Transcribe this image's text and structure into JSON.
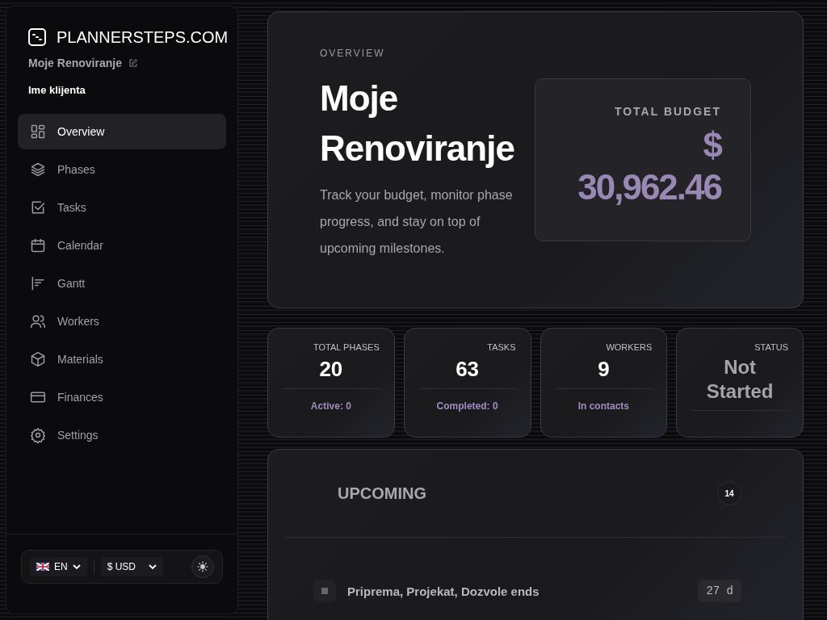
{
  "brand": {
    "name": "PLANNERSTEPS.COM"
  },
  "project": {
    "name": "Moje Renoviranje",
    "client": "Ime klijenta"
  },
  "nav": [
    {
      "label": "Overview",
      "selected": true
    },
    {
      "label": "Phases",
      "selected": false
    },
    {
      "label": "Tasks",
      "selected": false
    },
    {
      "label": "Calendar",
      "selected": false
    },
    {
      "label": "Gantt",
      "selected": false
    },
    {
      "label": "Workers",
      "selected": false
    },
    {
      "label": "Materials",
      "selected": false
    },
    {
      "label": "Finances",
      "selected": false
    },
    {
      "label": "Settings",
      "selected": false
    }
  ],
  "footer": {
    "language": "EN",
    "currency": "$ USD"
  },
  "hero": {
    "eyebrow": "OVERVIEW",
    "title": "Moje Renoviranje",
    "description": "Track your budget, monitor phase progress, and stay on top of upcoming milestones.",
    "budget_label": "TOTAL BUDGET",
    "budget_currency": "$",
    "budget_value": "30,962.46"
  },
  "stats": [
    {
      "label": "TOTAL PHASES",
      "value": "20",
      "note": "Active: 0",
      "kind": "number"
    },
    {
      "label": "TASKS",
      "value": "63",
      "note": "Completed: 0",
      "kind": "number"
    },
    {
      "label": "WORKERS",
      "value": "9",
      "note": "In contacts",
      "kind": "number"
    },
    {
      "label": "STATUS",
      "value": "Not Started",
      "kind": "status"
    }
  ],
  "upcoming": {
    "title": "UPCOMING",
    "count": "14",
    "items": [
      {
        "text": "Priprema, Projekat, Dozvole ends",
        "days": "27 d"
      }
    ]
  }
}
